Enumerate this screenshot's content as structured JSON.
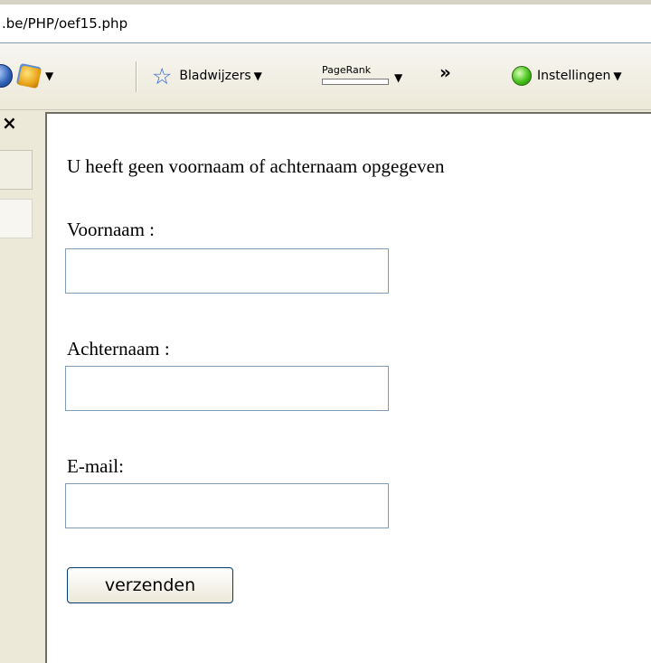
{
  "address_bar": {
    "url_text": ".be/PHP/oef15.php"
  },
  "toolbar": {
    "bookmarks_label": "Bladwijzers",
    "pagerank_label": "PageRank",
    "overflow_label": "»",
    "settings_label": "Instellingen"
  },
  "sidepanel": {
    "close_label": "×"
  },
  "form": {
    "message": "U heeft geen voornaam of achternaam opgegeven",
    "voornaam_label": "Voornaam :",
    "voornaam_value": "",
    "achternaam_label": "Achternaam :",
    "achternaam_value": "",
    "email_label": "E-mail:",
    "email_value": "",
    "submit_label": "verzenden"
  },
  "colors": {
    "input_border": "#7f9db9",
    "chrome_bg": "#ece9d8",
    "link_blue": "#2a64d0",
    "status_green": "#45c21c"
  },
  "icons": [
    "globe-icon",
    "toolbar-gear-icon",
    "star-icon",
    "green-status-icon",
    "close-icon"
  ]
}
